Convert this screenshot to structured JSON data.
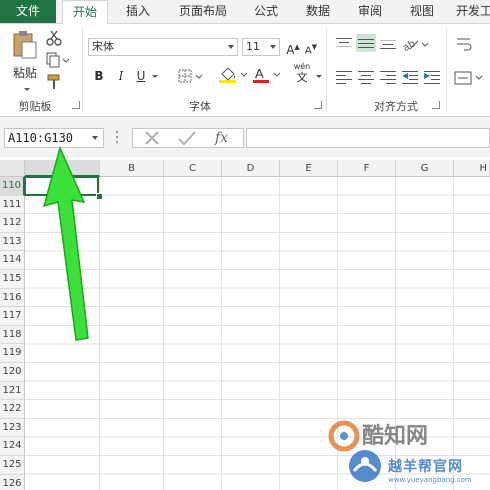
{
  "tabs": [
    "文件",
    "开始",
    "插入",
    "页面布局",
    "公式",
    "数据",
    "审阅",
    "视图",
    "开发工"
  ],
  "clipboard": {
    "paste_label": "粘贴",
    "group_label": "剪贴板"
  },
  "font": {
    "name": "宋体",
    "size": "11",
    "group_label": "字体",
    "bold": "B",
    "italic": "I",
    "underline": "U",
    "phonetic_top": "wén",
    "phonetic_bottom": "文"
  },
  "alignment": {
    "group_label": "对齐方式"
  },
  "name_box": {
    "value": "A110:G130"
  },
  "formula_bar": {
    "fx": "fx"
  },
  "columns": [
    "B",
    "C",
    "D",
    "E",
    "F",
    "G",
    "H"
  ],
  "rows": [
    "110",
    "111",
    "112",
    "113",
    "114",
    "115",
    "116",
    "117",
    "118",
    "119",
    "120",
    "121",
    "122",
    "123",
    "124",
    "125",
    "126"
  ],
  "watermark": {
    "main": "酷知网",
    "sub": "越羊帮官网",
    "url": "www.yueyangbang.com"
  },
  "colors": {
    "accent": "#217346",
    "arrow": "#2ecc2e"
  }
}
